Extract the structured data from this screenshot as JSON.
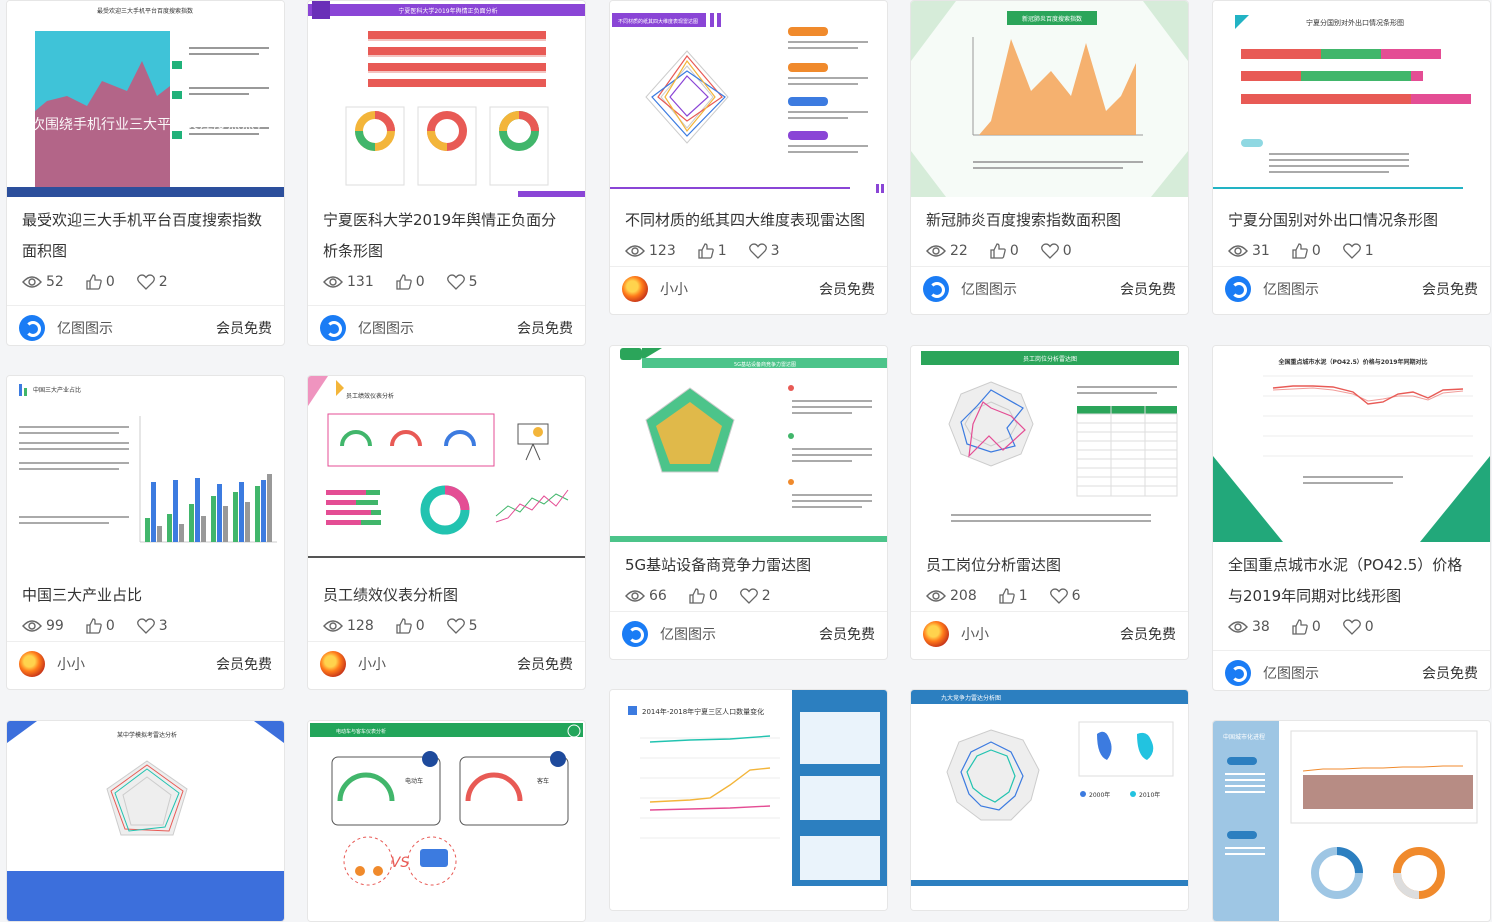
{
  "cards": [
    {
      "title": "最受欢迎三大手机平台百度搜索指数面积图",
      "views": "52",
      "likes": "0",
      "favs": "2",
      "author": "亿图图示",
      "price": "会员免费",
      "thumb_title": "最受欢迎三大手机平台百度搜索指数",
      "thumb_overlay": "本次围绕手机行业三大平台关注度热点，对比"
    },
    {
      "title": "宁夏医科大学2019年舆情正负面分析条形图",
      "views": "131",
      "likes": "0",
      "favs": "5",
      "author": "亿图图示",
      "price": "会员免费",
      "thumb_title": "宁夏医科大学2019年舆情正负面分析"
    },
    {
      "title": "不同材质的纸其四大维度表现雷达图",
      "views": "123",
      "likes": "1",
      "favs": "3",
      "author": "小小",
      "price": "会员免费",
      "thumb_title": "不同材质的纸其四大维度表现雷达图"
    },
    {
      "title": "新冠肺炎百度搜索指数面积图",
      "views": "22",
      "likes": "0",
      "favs": "0",
      "author": "亿图图示",
      "price": "会员免费",
      "thumb_title": "新冠肺炎百度搜索指数"
    },
    {
      "title": "宁夏分国别对外出口情况条形图",
      "views": "31",
      "likes": "0",
      "favs": "1",
      "author": "亿图图示",
      "price": "会员免费",
      "thumb_title": "宁夏分国别对外出口情况条形图"
    },
    {
      "title": "中国三大产业占比",
      "views": "99",
      "likes": "0",
      "favs": "3",
      "author": "小小",
      "price": "会员免费",
      "thumb_title": "中国三大产业占比"
    },
    {
      "title": "员工绩效仪表分析图",
      "views": "128",
      "likes": "0",
      "favs": "5",
      "author": "小小",
      "price": "会员免费",
      "thumb_title": "员工绩效仪表分析"
    },
    {
      "title": "5G基站设备商竞争力雷达图",
      "views": "66",
      "likes": "0",
      "favs": "2",
      "author": "亿图图示",
      "price": "会员免费",
      "thumb_title": "5G基站设备商竞争力雷达图"
    },
    {
      "title": "员工岗位分析雷达图",
      "views": "208",
      "likes": "1",
      "favs": "6",
      "author": "小小",
      "price": "会员免费",
      "thumb_title": "员工岗位分析雷达图"
    },
    {
      "title": "全国重点城市水泥（PO42.5）价格与2019年同期对比线形图",
      "views": "38",
      "likes": "0",
      "favs": "0",
      "author": "亿图图示",
      "price": "会员免费",
      "thumb_title": "全国重点城市水泥（PO42.5）价格与2019年同期对比"
    },
    {
      "thumb_title": "某中学模拟考雷达分析"
    },
    {
      "thumb_title": "电动车与客车仪表分析",
      "label_a": "电动车",
      "label_b": "客车",
      "vs": "VS"
    },
    {
      "thumb_title": "2014年-2018年宁夏三区人口数量变化"
    },
    {
      "thumb_title": "九大竞争力雷达分析图",
      "year_a": "2000年",
      "year_b": "2010年"
    },
    {
      "thumb_title": "中国城市化进程"
    }
  ],
  "colors": {
    "accent": "#1a7cf5",
    "green": "#20b27a",
    "purple": "#7a3fd1"
  }
}
